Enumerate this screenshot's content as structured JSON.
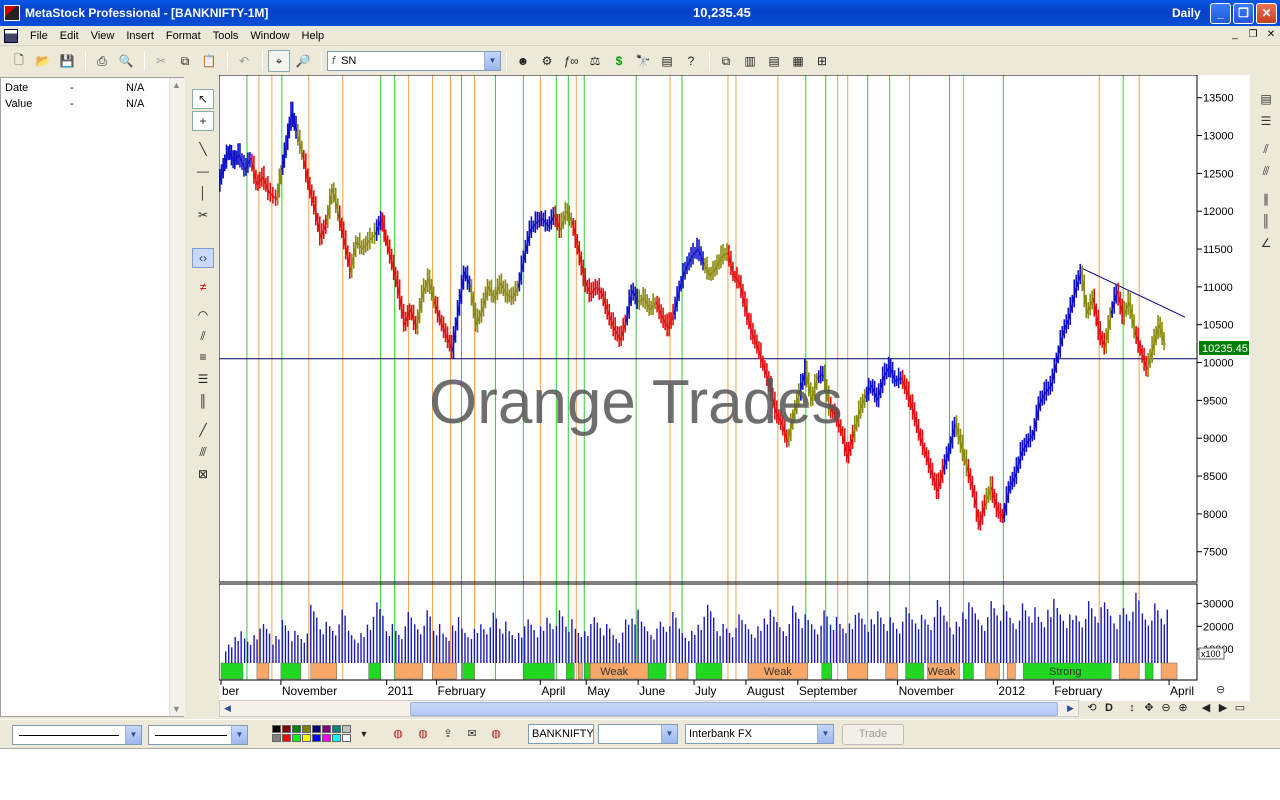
{
  "window": {
    "title": "MetaStock Professional - [BANKNIFTY-1M]",
    "last_price": "10,235.45",
    "periodicity": "Daily"
  },
  "menu": [
    "File",
    "Edit",
    "View",
    "Insert",
    "Format",
    "Tools",
    "Window",
    "Help"
  ],
  "toolbar": {
    "symbol_combo": "SN"
  },
  "data_window": {
    "rows": [
      {
        "label": "Date",
        "dash": "-",
        "value": "N/A"
      },
      {
        "label": "Value",
        "dash": "-",
        "value": "N/A"
      }
    ]
  },
  "bottom": {
    "symbol_field": "BANKNIFTY",
    "period_field": "",
    "source_field": "Interbank FX",
    "trade_button": "Trade"
  },
  "palette_colors": [
    "#000000",
    "#800000",
    "#008000",
    "#808000",
    "#000080",
    "#800080",
    "#008080",
    "#c0c0c0",
    "#808080",
    "#ff0000",
    "#00ff00",
    "#ffff00",
    "#0000ff",
    "#ff00ff",
    "#00ffff",
    "#ffffff"
  ],
  "chart_data": {
    "type": "line",
    "annotation": "Orange Trades",
    "price_label": "10235.45",
    "horizontal_line_value": 10050,
    "price_axis": {
      "ticks": [
        "13500",
        "13000",
        "12500",
        "12000",
        "11500",
        "11000",
        "10500",
        "10000",
        "9500",
        "9000",
        "8500",
        "8000",
        "7500"
      ],
      "ylim": [
        7100,
        13800
      ]
    },
    "volume_axis": {
      "ticks": [
        "30000",
        "20000",
        "10000"
      ],
      "multiplier": "x100",
      "ylim": [
        0,
        35000
      ]
    },
    "time_labels": [
      "ber",
      "November",
      "2011",
      "February",
      "April",
      "May",
      "June",
      "July",
      "August",
      "September",
      "November",
      "2012",
      "February",
      "April"
    ],
    "band_labels": [
      "Weak",
      "Weak",
      "Weak",
      "Strong"
    ],
    "colors": {
      "uptrend": "#1010c8",
      "neutral": "#8a8a10",
      "downtrend": "#e01010",
      "strong_band": "#22d822",
      "weak_band": "#f7a868",
      "axis_price_box": "#008000"
    },
    "price_series": [
      {
        "t": 0,
        "v": 12350,
        "c": "blue"
      },
      {
        "t": 5,
        "v": 12600,
        "c": "blue"
      },
      {
        "t": 10,
        "v": 12800,
        "c": "blue"
      },
      {
        "t": 15,
        "v": 12650,
        "c": "blue"
      },
      {
        "t": 20,
        "v": 12750,
        "c": "blue"
      },
      {
        "t": 26,
        "v": 12550,
        "c": "blue"
      },
      {
        "t": 32,
        "v": 12700,
        "c": "blue"
      },
      {
        "t": 38,
        "v": 12350,
        "c": "red"
      },
      {
        "t": 44,
        "v": 12450,
        "c": "red"
      },
      {
        "t": 50,
        "v": 12250,
        "c": "red"
      },
      {
        "t": 58,
        "v": 12150,
        "c": "red"
      },
      {
        "t": 63,
        "v": 12550,
        "c": "olive"
      },
      {
        "t": 68,
        "v": 12900,
        "c": "blue"
      },
      {
        "t": 73,
        "v": 13300,
        "c": "blue"
      },
      {
        "t": 78,
        "v": 13050,
        "c": "blue"
      },
      {
        "t": 84,
        "v": 12750,
        "c": "olive"
      },
      {
        "t": 90,
        "v": 12350,
        "c": "red"
      },
      {
        "t": 96,
        "v": 12050,
        "c": "red"
      },
      {
        "t": 102,
        "v": 11650,
        "c": "red"
      },
      {
        "t": 108,
        "v": 11850,
        "c": "red"
      },
      {
        "t": 114,
        "v": 12300,
        "c": "olive"
      },
      {
        "t": 120,
        "v": 11950,
        "c": "olive"
      },
      {
        "t": 126,
        "v": 11600,
        "c": "red"
      },
      {
        "t": 132,
        "v": 11200,
        "c": "red"
      },
      {
        "t": 138,
        "v": 11600,
        "c": "olive"
      },
      {
        "t": 144,
        "v": 11500,
        "c": "olive"
      },
      {
        "t": 150,
        "v": 11600,
        "c": "olive"
      },
      {
        "t": 157,
        "v": 11700,
        "c": "olive"
      },
      {
        "t": 163,
        "v": 11900,
        "c": "blue"
      },
      {
        "t": 168,
        "v": 11600,
        "c": "red"
      },
      {
        "t": 174,
        "v": 11300,
        "c": "red"
      },
      {
        "t": 180,
        "v": 10950,
        "c": "red"
      },
      {
        "t": 186,
        "v": 10500,
        "c": "red"
      },
      {
        "t": 192,
        "v": 10700,
        "c": "red"
      },
      {
        "t": 198,
        "v": 10450,
        "c": "red"
      },
      {
        "t": 204,
        "v": 10900,
        "c": "olive"
      },
      {
        "t": 210,
        "v": 11100,
        "c": "olive"
      },
      {
        "t": 216,
        "v": 10800,
        "c": "olive"
      },
      {
        "t": 222,
        "v": 10550,
        "c": "red"
      },
      {
        "t": 228,
        "v": 10350,
        "c": "red"
      },
      {
        "t": 234,
        "v": 10150,
        "c": "red"
      },
      {
        "t": 240,
        "v": 10700,
        "c": "blue"
      },
      {
        "t": 246,
        "v": 11200,
        "c": "blue"
      },
      {
        "t": 252,
        "v": 11000,
        "c": "blue"
      },
      {
        "t": 258,
        "v": 10500,
        "c": "olive"
      },
      {
        "t": 264,
        "v": 10700,
        "c": "olive"
      },
      {
        "t": 270,
        "v": 11000,
        "c": "olive"
      },
      {
        "t": 276,
        "v": 10850,
        "c": "olive"
      },
      {
        "t": 282,
        "v": 11050,
        "c": "olive"
      },
      {
        "t": 288,
        "v": 10900,
        "c": "olive"
      },
      {
        "t": 294,
        "v": 10850,
        "c": "olive"
      },
      {
        "t": 300,
        "v": 11000,
        "c": "olive"
      },
      {
        "t": 306,
        "v": 11400,
        "c": "blue"
      },
      {
        "t": 312,
        "v": 11750,
        "c": "blue"
      },
      {
        "t": 318,
        "v": 11850,
        "c": "blue"
      },
      {
        "t": 324,
        "v": 11900,
        "c": "blue"
      },
      {
        "t": 330,
        "v": 11800,
        "c": "blue"
      },
      {
        "t": 336,
        "v": 11950,
        "c": "blue"
      },
      {
        "t": 342,
        "v": 11750,
        "c": "red"
      },
      {
        "t": 348,
        "v": 12000,
        "c": "olive"
      },
      {
        "t": 354,
        "v": 11850,
        "c": "olive"
      },
      {
        "t": 360,
        "v": 11500,
        "c": "red"
      },
      {
        "t": 366,
        "v": 11100,
        "c": "red"
      },
      {
        "t": 372,
        "v": 10900,
        "c": "red"
      },
      {
        "t": 378,
        "v": 11000,
        "c": "red"
      },
      {
        "t": 384,
        "v": 10900,
        "c": "red"
      },
      {
        "t": 390,
        "v": 10650,
        "c": "red"
      },
      {
        "t": 396,
        "v": 10450,
        "c": "red"
      },
      {
        "t": 402,
        "v": 10300,
        "c": "red"
      },
      {
        "t": 408,
        "v": 10550,
        "c": "red"
      },
      {
        "t": 414,
        "v": 10950,
        "c": "blue"
      },
      {
        "t": 420,
        "v": 10800,
        "c": "blue"
      },
      {
        "t": 426,
        "v": 10850,
        "c": "olive"
      },
      {
        "t": 432,
        "v": 10700,
        "c": "olive"
      },
      {
        "t": 438,
        "v": 10800,
        "c": "olive"
      },
      {
        "t": 444,
        "v": 10600,
        "c": "red"
      },
      {
        "t": 450,
        "v": 10450,
        "c": "red"
      },
      {
        "t": 456,
        "v": 10650,
        "c": "red"
      },
      {
        "t": 462,
        "v": 11000,
        "c": "blue"
      },
      {
        "t": 468,
        "v": 11250,
        "c": "blue"
      },
      {
        "t": 474,
        "v": 11400,
        "c": "blue"
      },
      {
        "t": 480,
        "v": 11500,
        "c": "blue"
      },
      {
        "t": 486,
        "v": 11300,
        "c": "blue"
      },
      {
        "t": 492,
        "v": 11150,
        "c": "olive"
      },
      {
        "t": 498,
        "v": 11250,
        "c": "olive"
      },
      {
        "t": 504,
        "v": 11400,
        "c": "olive"
      },
      {
        "t": 510,
        "v": 11450,
        "c": "olive"
      },
      {
        "t": 516,
        "v": 11150,
        "c": "red"
      },
      {
        "t": 522,
        "v": 11050,
        "c": "red"
      },
      {
        "t": 528,
        "v": 10700,
        "c": "red"
      },
      {
        "t": 534,
        "v": 10400,
        "c": "red"
      },
      {
        "t": 540,
        "v": 10200,
        "c": "red"
      },
      {
        "t": 546,
        "v": 9950,
        "c": "red"
      },
      {
        "t": 552,
        "v": 9700,
        "c": "red"
      },
      {
        "t": 558,
        "v": 9350,
        "c": "red"
      },
      {
        "t": 564,
        "v": 9200,
        "c": "red"
      },
      {
        "t": 570,
        "v": 8950,
        "c": "red"
      },
      {
        "t": 576,
        "v": 9300,
        "c": "olive"
      },
      {
        "t": 582,
        "v": 9600,
        "c": "olive"
      },
      {
        "t": 588,
        "v": 9900,
        "c": "blue"
      },
      {
        "t": 594,
        "v": 9500,
        "c": "olive"
      },
      {
        "t": 600,
        "v": 9800,
        "c": "olive"
      },
      {
        "t": 606,
        "v": 9850,
        "c": "blue"
      },
      {
        "t": 612,
        "v": 9400,
        "c": "olive"
      },
      {
        "t": 618,
        "v": 9300,
        "c": "red"
      },
      {
        "t": 624,
        "v": 9100,
        "c": "red"
      },
      {
        "t": 630,
        "v": 8750,
        "c": "red"
      },
      {
        "t": 636,
        "v": 9050,
        "c": "red"
      },
      {
        "t": 642,
        "v": 9350,
        "c": "olive"
      },
      {
        "t": 648,
        "v": 9550,
        "c": "olive"
      },
      {
        "t": 654,
        "v": 9700,
        "c": "blue"
      },
      {
        "t": 660,
        "v": 9500,
        "c": "blue"
      },
      {
        "t": 666,
        "v": 9800,
        "c": "blue"
      },
      {
        "t": 672,
        "v": 9950,
        "c": "blue"
      },
      {
        "t": 678,
        "v": 9750,
        "c": "blue"
      },
      {
        "t": 684,
        "v": 9800,
        "c": "blue"
      },
      {
        "t": 690,
        "v": 9600,
        "c": "red"
      },
      {
        "t": 696,
        "v": 9350,
        "c": "red"
      },
      {
        "t": 702,
        "v": 9050,
        "c": "red"
      },
      {
        "t": 708,
        "v": 8800,
        "c": "red"
      },
      {
        "t": 714,
        "v": 8550,
        "c": "red"
      },
      {
        "t": 720,
        "v": 8300,
        "c": "red"
      },
      {
        "t": 726,
        "v": 8600,
        "c": "red"
      },
      {
        "t": 732,
        "v": 8850,
        "c": "blue"
      },
      {
        "t": 738,
        "v": 9200,
        "c": "blue"
      },
      {
        "t": 744,
        "v": 8900,
        "c": "olive"
      },
      {
        "t": 750,
        "v": 8600,
        "c": "olive"
      },
      {
        "t": 756,
        "v": 8300,
        "c": "red"
      },
      {
        "t": 762,
        "v": 7850,
        "c": "red"
      },
      {
        "t": 768,
        "v": 8150,
        "c": "red"
      },
      {
        "t": 774,
        "v": 8350,
        "c": "olive"
      },
      {
        "t": 780,
        "v": 8050,
        "c": "red"
      },
      {
        "t": 786,
        "v": 7950,
        "c": "red"
      },
      {
        "t": 792,
        "v": 8350,
        "c": "blue"
      },
      {
        "t": 798,
        "v": 8500,
        "c": "blue"
      },
      {
        "t": 804,
        "v": 8800,
        "c": "blue"
      },
      {
        "t": 810,
        "v": 8950,
        "c": "blue"
      },
      {
        "t": 816,
        "v": 9050,
        "c": "blue"
      },
      {
        "t": 822,
        "v": 9450,
        "c": "blue"
      },
      {
        "t": 828,
        "v": 9600,
        "c": "blue"
      },
      {
        "t": 834,
        "v": 9700,
        "c": "blue"
      },
      {
        "t": 840,
        "v": 10050,
        "c": "blue"
      },
      {
        "t": 846,
        "v": 10400,
        "c": "blue"
      },
      {
        "t": 852,
        "v": 10600,
        "c": "blue"
      },
      {
        "t": 858,
        "v": 10950,
        "c": "blue"
      },
      {
        "t": 864,
        "v": 11200,
        "c": "blue"
      },
      {
        "t": 870,
        "v": 10650,
        "c": "olive"
      },
      {
        "t": 876,
        "v": 10850,
        "c": "olive"
      },
      {
        "t": 882,
        "v": 10400,
        "c": "red"
      },
      {
        "t": 888,
        "v": 10200,
        "c": "red"
      },
      {
        "t": 894,
        "v": 10650,
        "c": "olive"
      },
      {
        "t": 900,
        "v": 10950,
        "c": "blue"
      },
      {
        "t": 906,
        "v": 10600,
        "c": "red"
      },
      {
        "t": 912,
        "v": 10800,
        "c": "olive"
      },
      {
        "t": 918,
        "v": 10400,
        "c": "olive"
      },
      {
        "t": 924,
        "v": 10150,
        "c": "red"
      },
      {
        "t": 930,
        "v": 9900,
        "c": "red"
      },
      {
        "t": 936,
        "v": 10200,
        "c": "olive"
      },
      {
        "t": 942,
        "v": 10500,
        "c": "olive"
      },
      {
        "t": 948,
        "v": 10235,
        "c": "olive"
      }
    ],
    "trendline": {
      "t1": 864,
      "v1": 11250,
      "t2": 968,
      "v2": 10600
    },
    "green_markers": [
      28,
      63,
      162,
      176,
      243,
      277,
      305,
      338,
      350,
      366,
      418,
      464,
      588,
      608,
      650,
      672,
      732,
      786,
      906
    ],
    "orange_markers": [
      40,
      53,
      90,
      124,
      190,
      214,
      232,
      256,
      322,
      358,
      452,
      510,
      518,
      560,
      620,
      630,
      692,
      746,
      882,
      922
    ],
    "volume": [
      12000,
      17000,
      14000,
      19000,
      21000,
      15000,
      24000,
      18000,
      16000,
      28000,
      22000,
      20000,
      26000,
      19000,
      17000,
      23000,
      29000,
      21000,
      18000,
      25000,
      22000,
      27000,
      20000,
      16000,
      24000,
      19000,
      18000,
      22000,
      26000,
      21000,
      17000,
      20000,
      23000,
      19000,
      25000,
      27000,
      22000,
      18000,
      21000,
      24000,
      20000,
      17000,
      23000,
      26000,
      21000,
      19000,
      22000,
      25000,
      20000,
      18000,
      23000,
      28000,
      21000,
      19000,
      24000,
      22000,
      20000,
      26000,
      23000,
      21000,
      29000,
      24000,
      22000,
      27000,
      23000,
      20000,
      25000,
      26000,
      22000,
      28000,
      24000,
      21000,
      27000,
      25000,
      23000,
      30000,
      26000,
      22000,
      29000,
      27000,
      24000,
      31000,
      28000,
      25000,
      30000,
      27000,
      23000,
      32000,
      28000,
      24000,
      26000,
      31000,
      27000,
      29000,
      25000,
      28000,
      33000,
      27000,
      30000,
      26000
    ]
  }
}
